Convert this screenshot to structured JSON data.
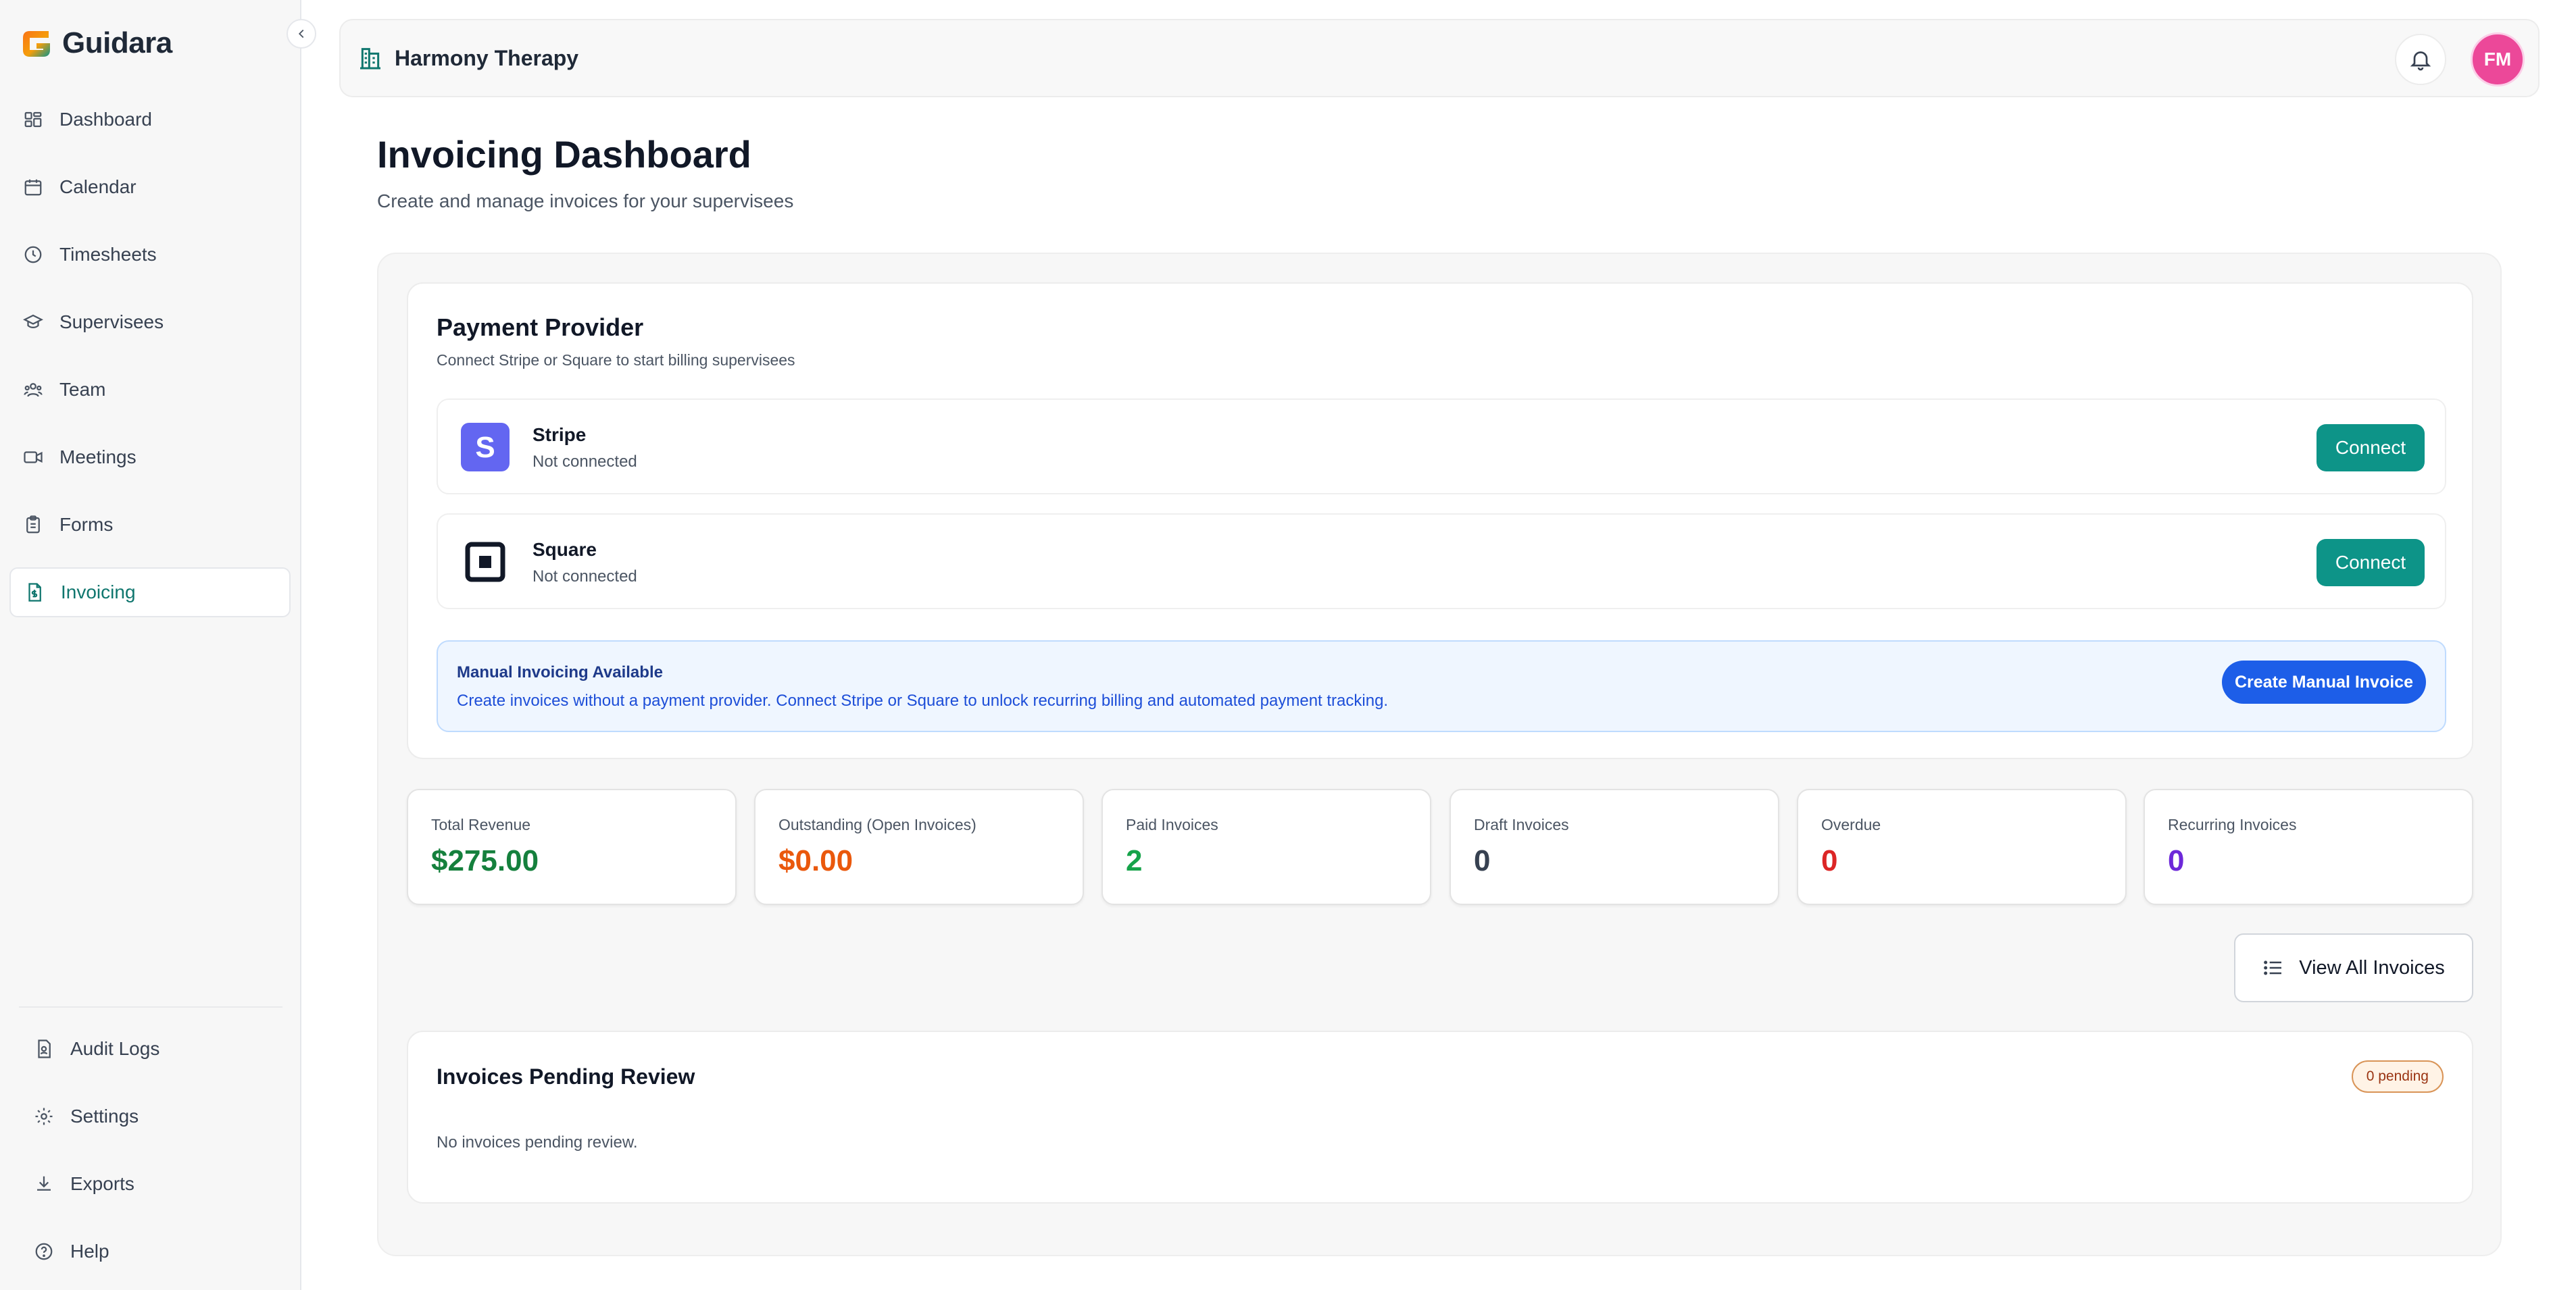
{
  "brand": {
    "name": "Guidara"
  },
  "sidebar": {
    "items": [
      {
        "label": "Dashboard",
        "icon": "dashboard-icon"
      },
      {
        "label": "Calendar",
        "icon": "calendar-icon"
      },
      {
        "label": "Timesheets",
        "icon": "clock-icon"
      },
      {
        "label": "Supervisees",
        "icon": "graduation-cap-icon"
      },
      {
        "label": "Team",
        "icon": "team-icon"
      },
      {
        "label": "Meetings",
        "icon": "video-icon"
      },
      {
        "label": "Forms",
        "icon": "clipboard-icon"
      },
      {
        "label": "Invoicing",
        "icon": "invoice-icon",
        "active": true
      }
    ],
    "bottom_items": [
      {
        "label": "Audit Logs",
        "icon": "audit-log-icon"
      },
      {
        "label": "Settings",
        "icon": "gear-icon"
      },
      {
        "label": "Exports",
        "icon": "download-icon"
      },
      {
        "label": "Help",
        "icon": "help-icon"
      }
    ]
  },
  "header": {
    "org_name": "Harmony Therapy",
    "avatar_initials": "FM"
  },
  "page": {
    "title": "Invoicing Dashboard",
    "subtitle": "Create and manage invoices for your supervisees"
  },
  "payment_provider": {
    "title": "Payment Provider",
    "subtitle": "Connect Stripe or Square to start billing supervisees",
    "providers": [
      {
        "name": "Stripe",
        "status": "Not connected",
        "button": "Connect"
      },
      {
        "name": "Square",
        "status": "Not connected",
        "button": "Connect"
      }
    ],
    "manual": {
      "title": "Manual Invoicing Available",
      "text": "Create invoices without a payment provider. Connect Stripe or Square to unlock recurring billing and automated payment tracking.",
      "button": "Create Manual Invoice"
    }
  },
  "stats": [
    {
      "label": "Total Revenue",
      "value": "$275.00",
      "color": "#15803d"
    },
    {
      "label": "Outstanding (Open Invoices)",
      "value": "$0.00",
      "color": "#ea580c"
    },
    {
      "label": "Paid Invoices",
      "value": "2",
      "color": "#16a34a"
    },
    {
      "label": "Draft Invoices",
      "value": "0",
      "color": "#374151"
    },
    {
      "label": "Overdue",
      "value": "0",
      "color": "#dc2626"
    },
    {
      "label": "Recurring Invoices",
      "value": "0",
      "color": "#6d28d9"
    }
  ],
  "view_all_label": "View All Invoices",
  "review": {
    "title": "Invoices Pending Review",
    "badge": "0 pending",
    "empty": "No invoices pending review."
  },
  "colors": {
    "accent": "#0d9488",
    "primary_blue": "#1d5ee8",
    "stripe": "#6366f1",
    "avatar": "#ec4899"
  }
}
